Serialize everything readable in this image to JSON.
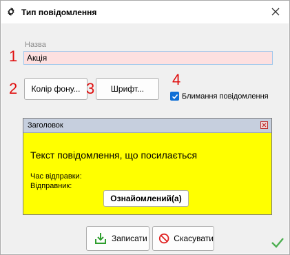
{
  "window": {
    "title": "Тип повідомлення",
    "icon": "gear-icon",
    "close_icon": "close-icon"
  },
  "form": {
    "name_label": "Назва",
    "name_value": "Акція",
    "color_button": "Колір фону...",
    "font_button": "Шрифт...",
    "blink_label": "Блимання повідомлення",
    "blink_checked": true
  },
  "annotations": {
    "n1": "1",
    "n2": "2",
    "n3": "3",
    "n4": "4",
    "color": "#e01010"
  },
  "preview": {
    "header": "Заголовок",
    "message": "Текст повідомлення, що посилається",
    "time_label": "Час відправки:",
    "sender_label": "Відправник:",
    "ack_button": "Ознайомлений(а)",
    "background": "#ffff00"
  },
  "footer": {
    "save_button": "Записати",
    "cancel_button": "Скасувати",
    "ok_icon": "checkmark-icon"
  }
}
